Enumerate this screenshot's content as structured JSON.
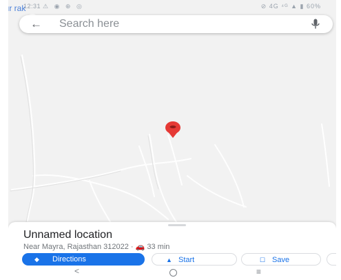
{
  "status_bar": {
    "time": "12:31",
    "left_icons": "⚠ ◉ ⊕ ◎",
    "right_icons": "⊘ 4G ⁴ᴳ ▲ ▮ 60%"
  },
  "corner_label": "our rak",
  "search": {
    "placeholder": "Search here"
  },
  "place": {
    "title": "Unnamed location",
    "subtitle": "Near Mayra, Rajasthan 312022 · 🚗 33 min"
  },
  "actions": {
    "directions_label": "Directions",
    "start_label": "Start",
    "save_label": "Save"
  },
  "nav": {
    "back": "<",
    "recent": "≡"
  },
  "colors": {
    "accent": "#1a73e8",
    "pin": "#e53935",
    "map_bg": "#f2f2f2"
  },
  "icons": {
    "back": "arrow-back-icon",
    "mic": "mic-icon",
    "pin": "map-pin-icon",
    "directions": "directions-icon",
    "start": "navigation-arrow-icon",
    "save": "bookmark-icon"
  }
}
